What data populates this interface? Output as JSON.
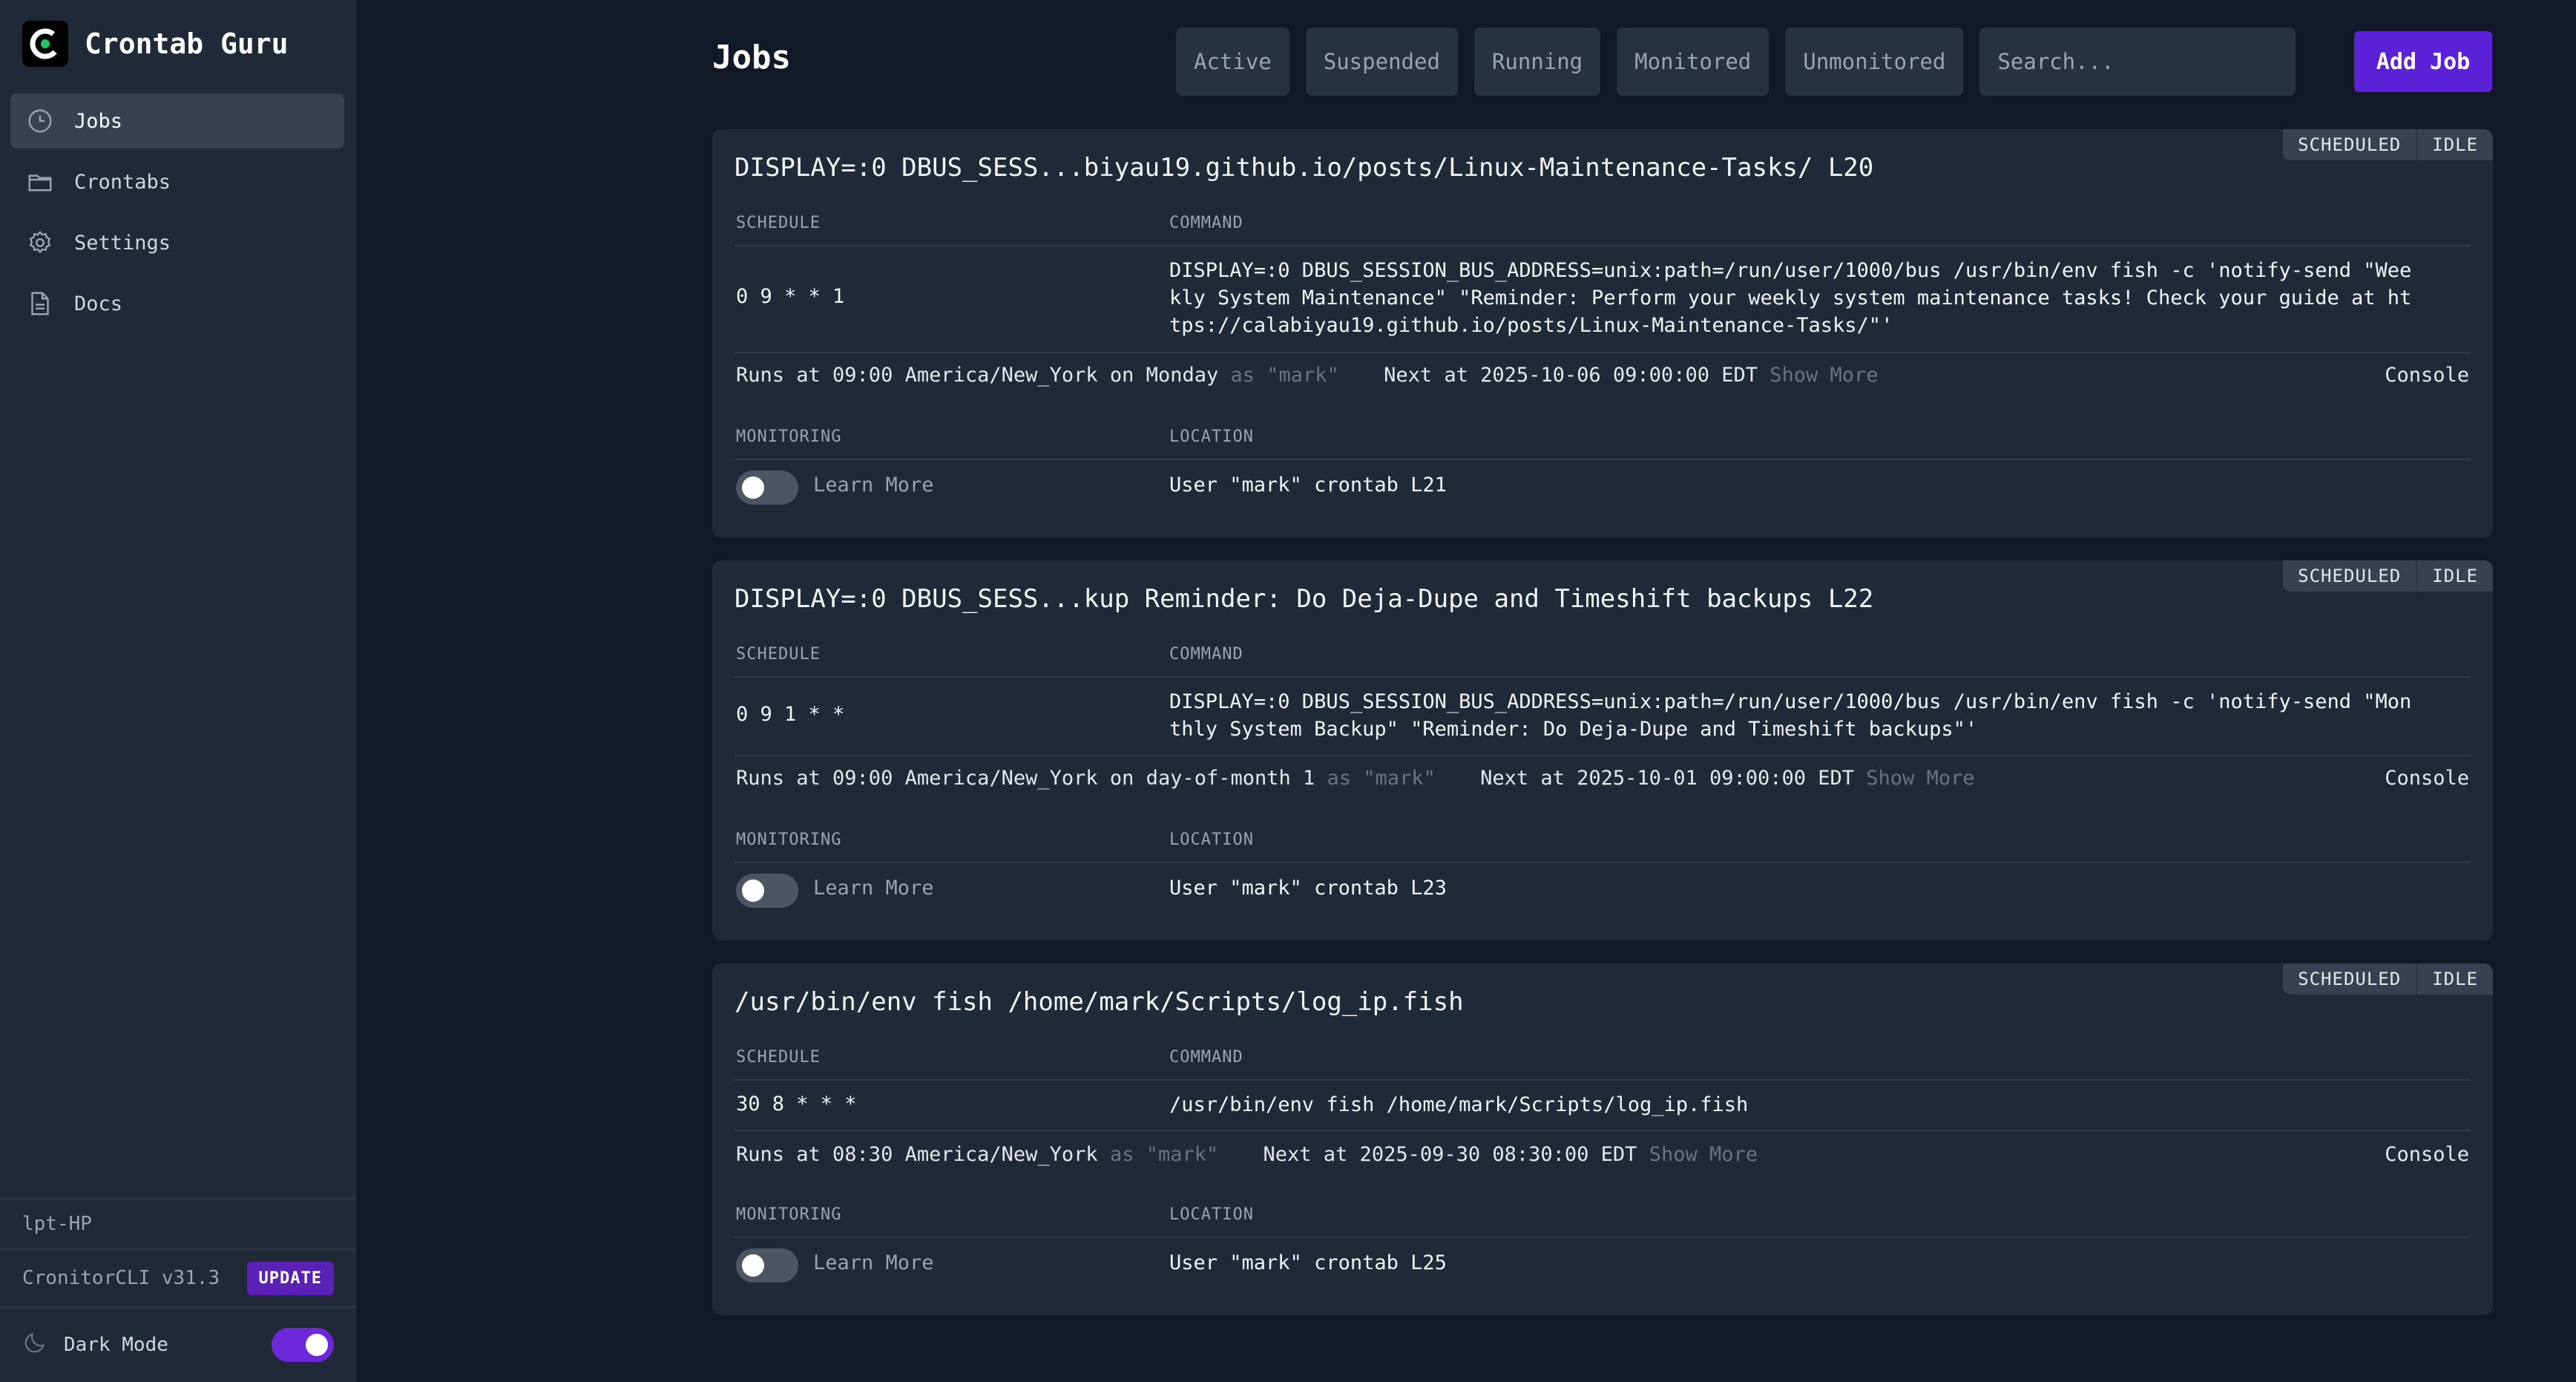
{
  "app": {
    "name": "Crontab Guru"
  },
  "sidebar": {
    "items": [
      {
        "label": "Jobs",
        "icon": "clock-icon",
        "active": true
      },
      {
        "label": "Crontabs",
        "icon": "folder-icon",
        "active": false
      },
      {
        "label": "Settings",
        "icon": "gear-icon",
        "active": false
      },
      {
        "label": "Docs",
        "icon": "document-icon",
        "active": false
      }
    ],
    "hostname": "lpt-HP",
    "cli_version": "CronitorCLI v31.3",
    "update_label": "UPDATE",
    "dark_mode_label": "Dark Mode",
    "dark_mode_on": true
  },
  "header": {
    "title": "Jobs",
    "filters": [
      "Active",
      "Suspended",
      "Running",
      "Monitored",
      "Unmonitored"
    ],
    "search_placeholder": "Search...",
    "add_job_label": "Add Job"
  },
  "labels": {
    "schedule": "SCHEDULE",
    "command": "COMMAND",
    "monitoring": "MONITORING",
    "location": "LOCATION",
    "learn_more": "Learn More",
    "console": "Console",
    "show_more": "Show More"
  },
  "jobs": [
    {
      "title": "DISPLAY=:0 DBUS_SESS...biyau19.github.io/posts/Linux-Maintenance-Tasks/ L20",
      "status": "SCHEDULED",
      "state": "IDLE",
      "schedule": "0 9 * * 1",
      "command": "DISPLAY=:0 DBUS_SESSION_BUS_ADDRESS=unix:path=/run/user/1000/bus /usr/bin/env fish -c 'notify-send \"Weekly System Maintenance\" \"Reminder: Perform your weekly system maintenance tasks! Check your guide at https://calabiyau19.github.io/posts/Linux-Maintenance-Tasks/\"'",
      "runs_at": "Runs at 09:00 America/New_York on Monday",
      "runs_as": "as \"mark\"",
      "next_at": "Next at 2025-10-06 09:00:00 EDT",
      "monitoring_on": false,
      "location": "User \"mark\" crontab L21"
    },
    {
      "title": "DISPLAY=:0 DBUS_SESS...kup Reminder: Do Deja-Dupe and Timeshift backups L22",
      "status": "SCHEDULED",
      "state": "IDLE",
      "schedule": "0 9 1 * *",
      "command": "DISPLAY=:0 DBUS_SESSION_BUS_ADDRESS=unix:path=/run/user/1000/bus /usr/bin/env fish -c 'notify-send \"Monthly System Backup\" \"Reminder: Do Deja-Dupe and Timeshift backups\"'",
      "runs_at": "Runs at 09:00 America/New_York on day-of-month 1",
      "runs_as": "as \"mark\"",
      "next_at": "Next at 2025-10-01 09:00:00 EDT",
      "monitoring_on": false,
      "location": "User \"mark\" crontab L23"
    },
    {
      "title": "/usr/bin/env fish /home/mark/Scripts/log_ip.fish",
      "status": "SCHEDULED",
      "state": "IDLE",
      "schedule": "30 8 * * *",
      "command": "/usr/bin/env fish /home/mark/Scripts/log_ip.fish",
      "runs_at": "Runs at 08:30 America/New_York",
      "runs_as": "as \"mark\"",
      "next_at": "Next at 2025-09-30 08:30:00 EDT",
      "monitoring_on": false,
      "location": "User \"mark\" crontab L25"
    }
  ]
}
